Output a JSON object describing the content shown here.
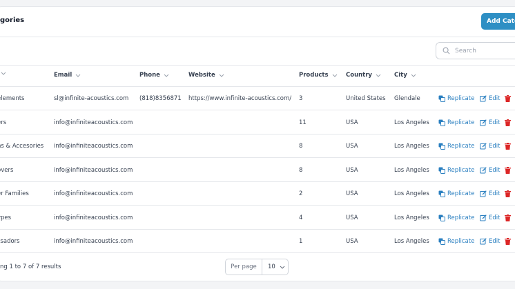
{
  "header": {
    "title": "gories",
    "add_button": "Add Categ"
  },
  "search": {
    "placeholder": "Search"
  },
  "columns": [
    "",
    "Email",
    "Phone",
    "Website",
    "Products",
    "Country",
    "City"
  ],
  "actions": {
    "replicate": "Replicate",
    "edit": "Edit"
  },
  "rows": [
    {
      "name": "elements",
      "email": "sl@infinite-acoustics.com",
      "phone": "(818)8356871",
      "website": "https://www.infinite-acoustics.com/",
      "products": "3",
      "country": "United States",
      "city": "Glendale"
    },
    {
      "name": "ers",
      "email": "info@infiniteacoustics.com",
      "phone": "",
      "website": "",
      "products": "11",
      "country": "USA",
      "city": "Los Angeles"
    },
    {
      "name": "ns & Accesories",
      "email": "info@infiniteacoustics.com",
      "phone": "",
      "website": "",
      "products": "8",
      "country": "USA",
      "city": "Los Angeles"
    },
    {
      "name": "overs",
      "email": "info@infiniteacoustics.com",
      "phone": "",
      "website": "",
      "products": "8",
      "country": "USA",
      "city": "Los Angeles"
    },
    {
      "name": "er Families",
      "email": "info@infiniteacoustics.com",
      "phone": "",
      "website": "",
      "products": "2",
      "country": "USA",
      "city": "Los Angeles"
    },
    {
      "name": "ypes",
      "email": "info@infiniteacoustics.com",
      "phone": "",
      "website": "",
      "products": "4",
      "country": "USA",
      "city": "Los Angeles"
    },
    {
      "name": "ssadors",
      "email": "info@infiniteacoustics.com",
      "phone": "",
      "website": "",
      "products": "1",
      "country": "USA",
      "city": "Los Angeles"
    }
  ],
  "footer": {
    "results": "ng 1 to 7 of 7 results",
    "per_page_label": "Per page",
    "per_page_value": "10"
  },
  "colors": {
    "accent": "#2e8fc4",
    "link": "#2a7fc0",
    "danger": "#dc2626"
  },
  "icons": [
    "search-icon",
    "chevron-down-icon",
    "replicate-icon",
    "edit-icon",
    "trash-icon"
  ]
}
